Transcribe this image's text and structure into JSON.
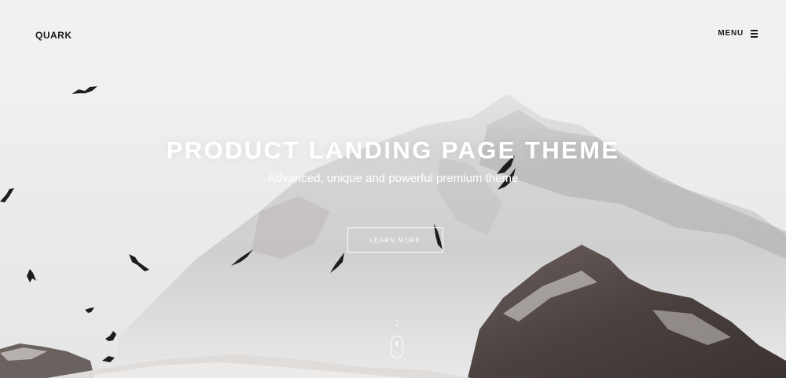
{
  "header": {
    "logo": "QUARK",
    "menu_label": "MENU",
    "menu_icon": "hamburger-icon"
  },
  "hero": {
    "title": "PRODUCT LANDING PAGE THEME",
    "subtitle": "Advanced, unique and powerful premium theme",
    "cta_label": "LEARN MORE",
    "scroll_icon": "mouse-scroll-icon",
    "background_icon": "snowy-mountain-with-birds"
  },
  "colors": {
    "text_dark": "#1a1a1a",
    "text_light": "#ffffff",
    "sky": "#eeeeee",
    "rock": "#4a4040"
  }
}
